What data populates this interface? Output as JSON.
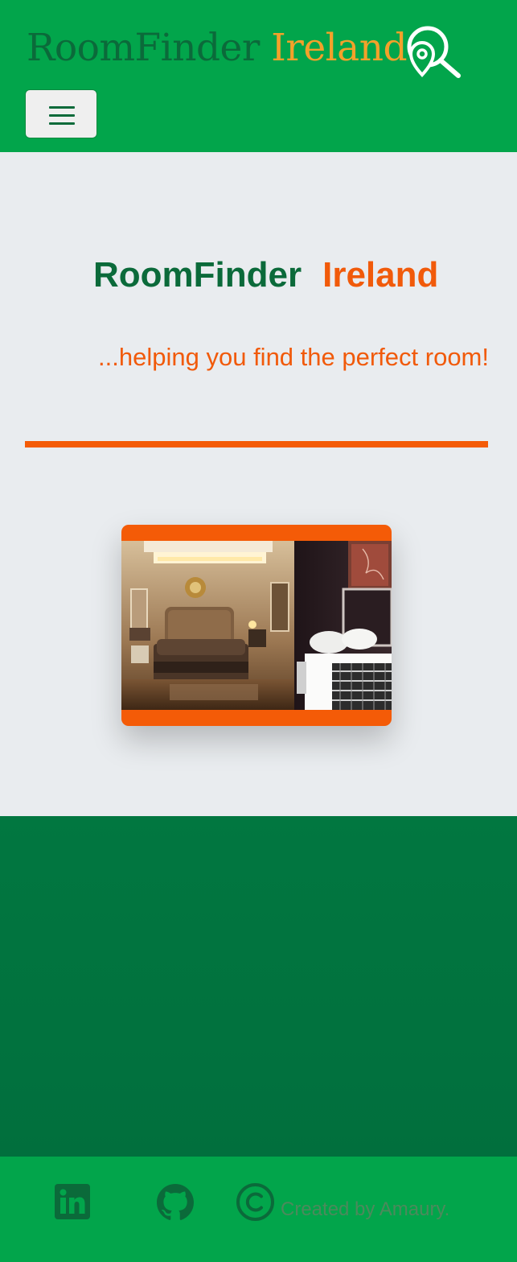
{
  "navbar": {
    "brand_part1": "RoomFinder",
    "brand_part2": "Ireland",
    "logo_icon": "location-search-icon",
    "toggler_icon": "hamburger-menu-icon"
  },
  "hero": {
    "title_part1": "RoomFinder",
    "title_part2": "Ireland",
    "tagline": "...helping you find the perfect room!",
    "photos": [
      "luxury bedroom with tufted headboard",
      "hotel bed with white linens and patterned throw"
    ]
  },
  "footer": {
    "icons": [
      "linkedin-icon",
      "github-icon",
      "copyright-icon"
    ],
    "credit": "Created by Amaury."
  },
  "colors": {
    "navbar_green": "#02a54b",
    "dark_green": "#0b6a3a",
    "accent_orange": "#f15a0a",
    "brand_orange": "#f3a12a",
    "hero_bg": "#e9ecef",
    "section_green": "#017740"
  }
}
